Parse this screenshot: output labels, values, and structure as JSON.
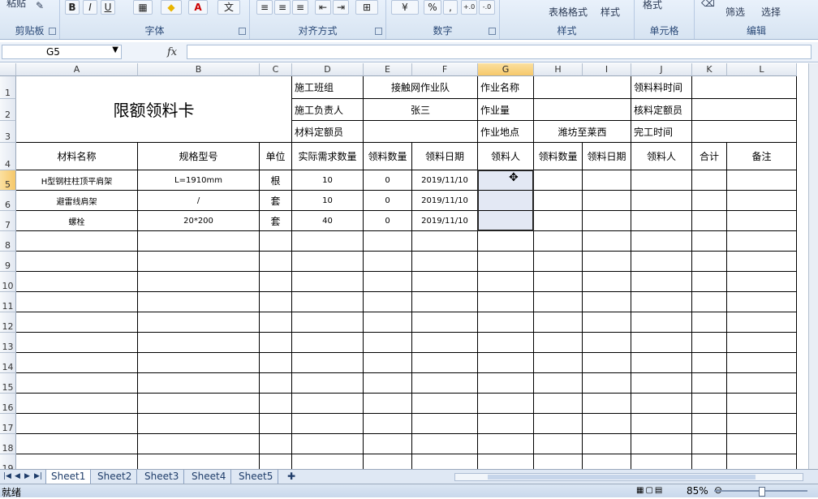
{
  "ribbon": {
    "groups": [
      {
        "label": "剪贴板"
      },
      {
        "label": "字体"
      },
      {
        "label": "对齐方式"
      },
      {
        "label": "数字"
      },
      {
        "label": "样式"
      },
      {
        "label": "单元格"
      },
      {
        "label": "编辑"
      }
    ],
    "paste_label": "粘贴",
    "bold": "B",
    "italic": "I",
    "underline": "U",
    "font_color": "A",
    "wen": "文",
    "percent": "%",
    "comma": ",",
    "inc_decimal": "+.0",
    "dec_decimal": "-.0",
    "table_format": "表格格式",
    "cell_style": "样式",
    "format_label": "格式",
    "filter_label": "筛选",
    "select_label": "选择"
  },
  "formula_bar": {
    "name_box": "G5",
    "fx": "fx",
    "formula": ""
  },
  "columns": [
    "A",
    "B",
    "C",
    "D",
    "E",
    "F",
    "G",
    "H",
    "I",
    "J",
    "K",
    "L"
  ],
  "rows": [
    "1",
    "2",
    "3",
    "4",
    "5",
    "6",
    "7",
    "8",
    "9",
    "10",
    "11",
    "12",
    "13",
    "14",
    "15",
    "16",
    "17",
    "18",
    "19"
  ],
  "sheet": {
    "title": "限额领料卡",
    "info": {
      "d1": "施工班组",
      "e1": "接触网作业队",
      "g1": "作业名称",
      "j1": "领料料时间",
      "d2": "施工负责人",
      "e2": "张三",
      "g2": "作业量",
      "j2": "核料定额员",
      "d3": "材料定额员",
      "g3": "作业地点",
      "h3": "潍坊至莱西",
      "j3": "完工时间"
    },
    "headers": [
      "材料名称",
      "规格型号",
      "单位",
      "实际需求数量",
      "领料数量",
      "领料日期",
      "领料人",
      "领料数量",
      "领料日期",
      "领料人",
      "合计",
      "备注"
    ],
    "data_rows": [
      [
        "H型钢柱柱顶平肩架",
        "L=1910mm",
        "根",
        "10",
        "0",
        "2019/11/10",
        "",
        "",
        "",
        "",
        "",
        ""
      ],
      [
        "避雷线肩架",
        "/",
        "套",
        "10",
        "0",
        "2019/11/10",
        "",
        "",
        "",
        "",
        "",
        ""
      ],
      [
        "螺栓",
        "20*200",
        "套",
        "40",
        "0",
        "2019/11/10",
        "",
        "",
        "",
        "",
        "",
        ""
      ]
    ]
  },
  "sheet_tabs": [
    "Sheet1",
    "Sheet2",
    "Sheet3",
    "Sheet4",
    "Sheet5"
  ],
  "active_tab": "Sheet1",
  "status": {
    "ready": "就绪",
    "zoom": "85%"
  },
  "colors": {
    "selected_header": "#f6c86a",
    "selected_cell": "#e3e8f4",
    "ribbon_bg": "#d7e4f2"
  }
}
